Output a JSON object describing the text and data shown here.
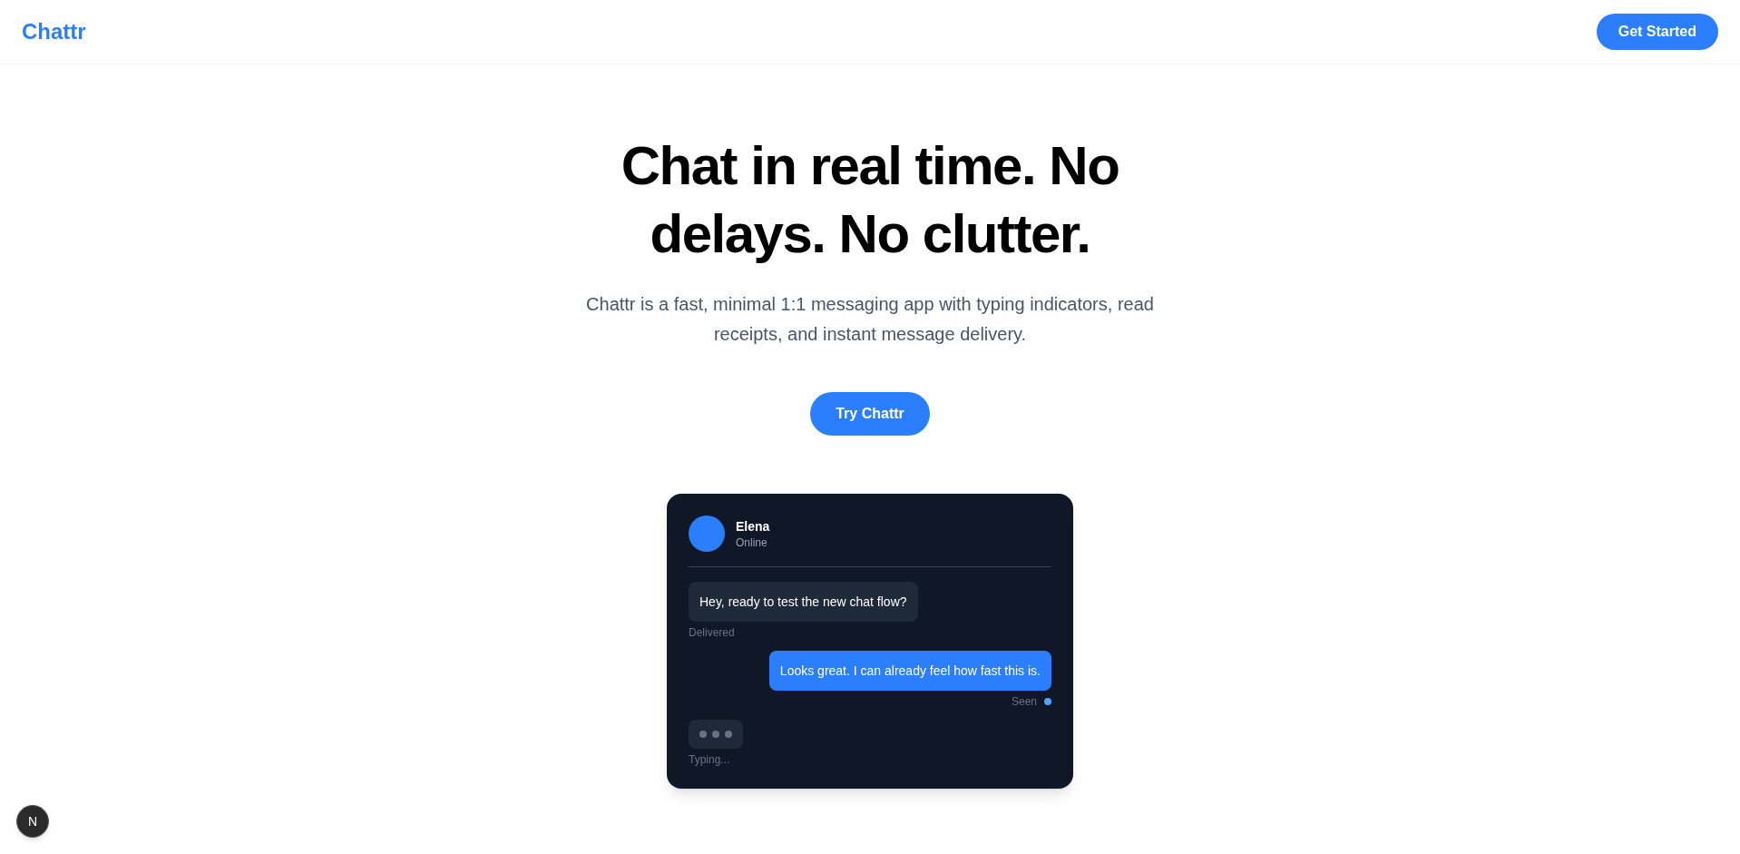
{
  "header": {
    "logo": "Chattr",
    "cta": "Get Started"
  },
  "hero": {
    "title": "Chat in real time. No delays. No clutter.",
    "subtitle": "Chattr is a fast, minimal 1:1 messaging app with typing indicators, read receipts, and instant message delivery.",
    "button": "Try Chattr"
  },
  "chat_preview": {
    "contact": {
      "name": "Elena",
      "status": "Online"
    },
    "messages": [
      {
        "kind": "received",
        "text": "Hey, ready to test the new chat flow?",
        "label": "Delivered",
        "seen": false
      },
      {
        "kind": "sent",
        "text": "Looks great. I can already feel how fast this is.",
        "label": "Seen",
        "seen": true
      },
      {
        "kind": "typing",
        "label": "Typing..."
      }
    ]
  },
  "dev_badge": {
    "label": "N"
  }
}
